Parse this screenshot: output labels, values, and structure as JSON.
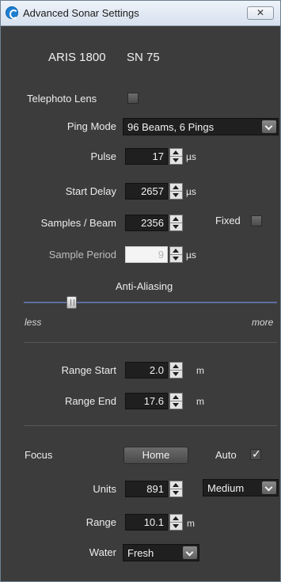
{
  "window": {
    "title": "Advanced Sonar Settings",
    "close_glyph": "✕"
  },
  "device": {
    "model": "ARIS 1800",
    "serial": "SN 75"
  },
  "telephoto": {
    "label": "Telephoto Lens",
    "checked": false
  },
  "ping_mode": {
    "label": "Ping Mode",
    "value": "96 Beams, 6 Pings"
  },
  "pulse": {
    "label": "Pulse",
    "value": "17",
    "unit": "µs"
  },
  "start_delay": {
    "label": "Start Delay",
    "value": "2657",
    "unit": "µs"
  },
  "samples_per_beam": {
    "label": "Samples / Beam",
    "value": "2356"
  },
  "fixed": {
    "label": "Fixed",
    "checked": false
  },
  "sample_period": {
    "label": "Sample Period",
    "value": "9",
    "unit": "µs",
    "enabled": false
  },
  "anti_aliasing": {
    "label": "Anti-Aliasing",
    "min_label": "less",
    "max_label": "more",
    "level": 0.18
  },
  "range_start": {
    "label": "Range Start",
    "value": "2.0",
    "unit": "m"
  },
  "range_end": {
    "label": "Range End",
    "value": "17.6",
    "unit": "m"
  },
  "focus": {
    "label": "Focus",
    "home_label": "Home",
    "auto_label": "Auto",
    "auto_checked": true,
    "units_label": "Units",
    "units_value": "891",
    "speed_value": "Medium",
    "range_label": "Range",
    "range_value": "10.1",
    "range_unit": "m"
  },
  "water": {
    "label": "Water",
    "value": "Fresh"
  },
  "colors": {
    "panel_bg": "#3c3c3c",
    "slider_track": "#5d6fa0"
  }
}
